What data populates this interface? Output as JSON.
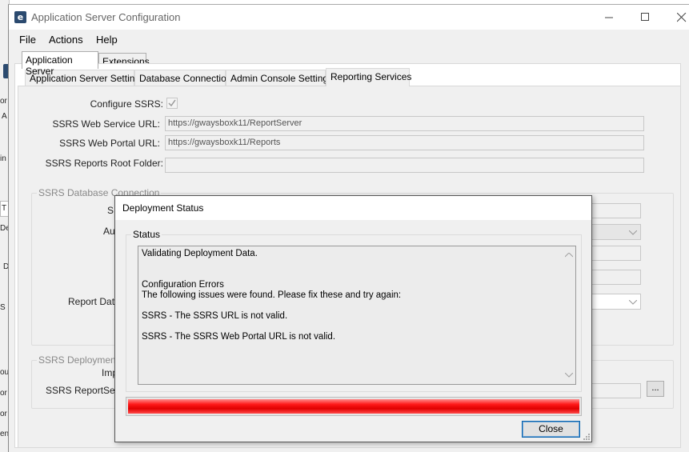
{
  "window": {
    "title": "Application Server Configuration",
    "icon_letter": "e"
  },
  "menu": {
    "items": [
      "File",
      "Actions",
      "Help"
    ]
  },
  "top_tabs": [
    {
      "label": "Application Server",
      "active": true
    },
    {
      "label": "Extensions",
      "active": false
    }
  ],
  "sub_tabs": [
    {
      "label": "Application Server Settings",
      "active": false
    },
    {
      "label": "Database Connection",
      "active": false
    },
    {
      "label": "Admin Console Settings",
      "active": false
    },
    {
      "label": "Reporting Services",
      "active": true
    }
  ],
  "form": {
    "configure_ssrs_label": "Configure SSRS:",
    "configure_ssrs_checked": true,
    "web_service_url_label": "SSRS Web Service URL:",
    "web_service_url_value": "https://gwaysboxk11/ReportServer",
    "web_portal_url_label": "SSRS Web Portal URL:",
    "web_portal_url_value": "https://gwaysboxk11/Reports",
    "reports_root_folder_label": "SSRS Reports Root Folder:",
    "reports_root_folder_value": ""
  },
  "db_connection_group": {
    "legend": "SSRS Database Connection",
    "partial_label_1": "S",
    "partial_label_2": "Aut",
    "partial_label_3": "Report Data"
  },
  "deployment_group": {
    "legend": "SSRS Deployment",
    "partial_label_1": "Imp",
    "partial_label_2": "SSRS ReportServ",
    "browse_button": "..."
  },
  "dialog": {
    "title": "Deployment Status",
    "status_legend": "Status",
    "status_text": "Validating Deployment Data.\n\n\nConfiguration Errors\nThe following issues were found. Please fix these and try again:\n\nSSRS - The SSRS URL is not valid.\n\nSSRS - The SSRS Web Portal URL is not valid.",
    "progress_percent": 100,
    "progress_color": "#ff0000",
    "close_button": "Close"
  },
  "background_window_fragments": [
    "or",
    "A",
    "in",
    "T",
    "De",
    "D",
    "S",
    "ou",
    "or",
    "or",
    "en"
  ]
}
